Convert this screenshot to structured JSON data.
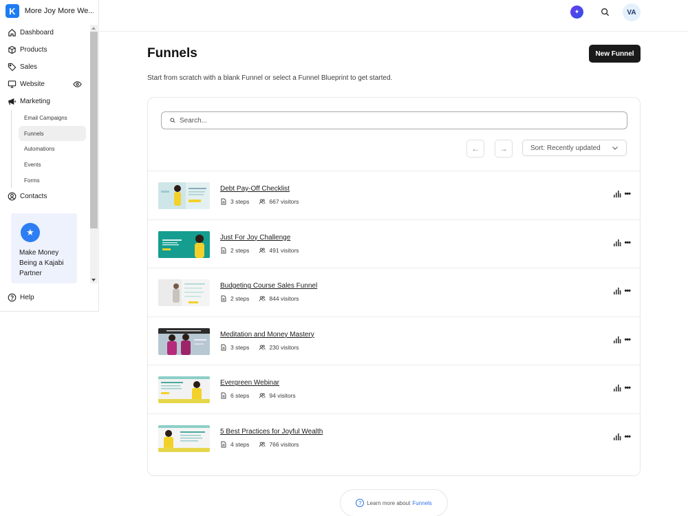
{
  "brand": {
    "name": "More Joy More We...",
    "logo_letter": "K",
    "logo_color": "#1d7cf2"
  },
  "sidebar": {
    "items": [
      {
        "label": "Dashboard",
        "icon": "home-icon"
      },
      {
        "label": "Products",
        "icon": "box-icon"
      },
      {
        "label": "Sales",
        "icon": "tag-icon"
      },
      {
        "label": "Website",
        "icon": "monitor-icon"
      },
      {
        "label": "Marketing",
        "icon": "megaphone-icon"
      }
    ],
    "marketing_sub": [
      "Email Campaigns",
      "Funnels",
      "Automations",
      "Events",
      "Forms"
    ],
    "contacts": "Contacts",
    "help": "Help",
    "partner_promo": "Make Money Being a Kajabi Partner"
  },
  "topbar": {
    "avatar_initials": "VA"
  },
  "page": {
    "title": "Funnels",
    "new_button": "New Funnel",
    "subtitle": "Start from scratch with a blank Funnel or select a Funnel Blueprint to get started."
  },
  "search": {
    "placeholder": "Search..."
  },
  "sort": {
    "label": "Sort: Recently updated"
  },
  "funnels": [
    {
      "title": "Debt Pay-Off Checklist",
      "steps": "3 steps",
      "visitors": "667 visitors"
    },
    {
      "title": "Just For Joy Challenge",
      "steps": "2 steps",
      "visitors": "491 visitors"
    },
    {
      "title": "Budgeting Course Sales Funnel",
      "steps": "2 steps",
      "visitors": "844 visitors"
    },
    {
      "title": "Meditation and Money Mastery",
      "steps": "3 steps",
      "visitors": "230 visitors"
    },
    {
      "title": "Evergreen Webinar",
      "steps": "6 steps",
      "visitors": "94 visitors"
    },
    {
      "title": "5 Best Practices for Joyful Wealth",
      "steps": "4 steps",
      "visitors": "766 visitors"
    }
  ],
  "footer": {
    "learn_text": "Learn more about",
    "learn_link": "Funnels"
  }
}
